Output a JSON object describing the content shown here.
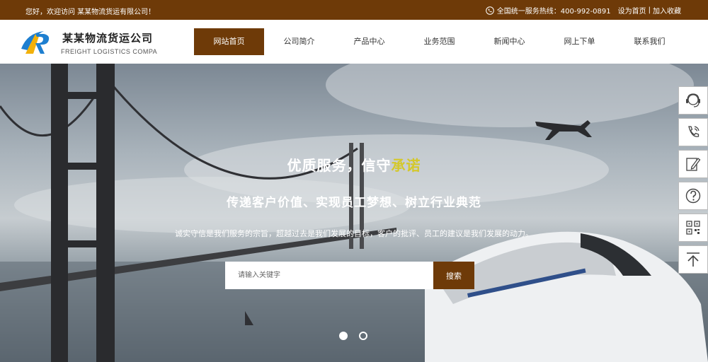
{
  "topbar": {
    "welcome": "您好，欢迎访问 某某物流货运有限公司！",
    "hotline": "全国统一服务热线：400-992-0891",
    "set_home": "设为首页",
    "separator": "|",
    "add_favorite": "加入收藏"
  },
  "brand": {
    "name": "某某物流货运公司",
    "en_name": "FREIGHT LOGISTICS COMPA"
  },
  "nav": {
    "items": [
      {
        "label": "网站首页"
      },
      {
        "label": "公司简介"
      },
      {
        "label": "产品中心"
      },
      {
        "label": "业务范围"
      },
      {
        "label": "新闻中心"
      },
      {
        "label": "网上下单"
      },
      {
        "label": "联系我们"
      }
    ],
    "active_index": 0
  },
  "hero": {
    "slogan_main": "优质服务，信守",
    "slogan_highlight": "承诺",
    "tagline": "传递客户价值、实现员工梦想、树立行业典范",
    "description": "诚实守信是我们服务的宗旨，超越过去是我们发展的目标，客户的批评、员工的建议是我们发展的动力。",
    "search_placeholder": "请输入关键字",
    "search_button": "搜索",
    "slides_total": 2,
    "active_slide": 0
  },
  "side_tools": [
    {
      "icon": "customer-service-icon"
    },
    {
      "icon": "phone-icon"
    },
    {
      "icon": "edit-icon"
    },
    {
      "icon": "help-icon"
    },
    {
      "icon": "qrcode-icon"
    },
    {
      "icon": "back-to-top-icon"
    }
  ],
  "colors": {
    "brand_brown": "#6e3a08",
    "slogan_highlight": "#d4c82a",
    "logo_blue": "#1e7fd0",
    "logo_yellow": "#f2b10a"
  }
}
